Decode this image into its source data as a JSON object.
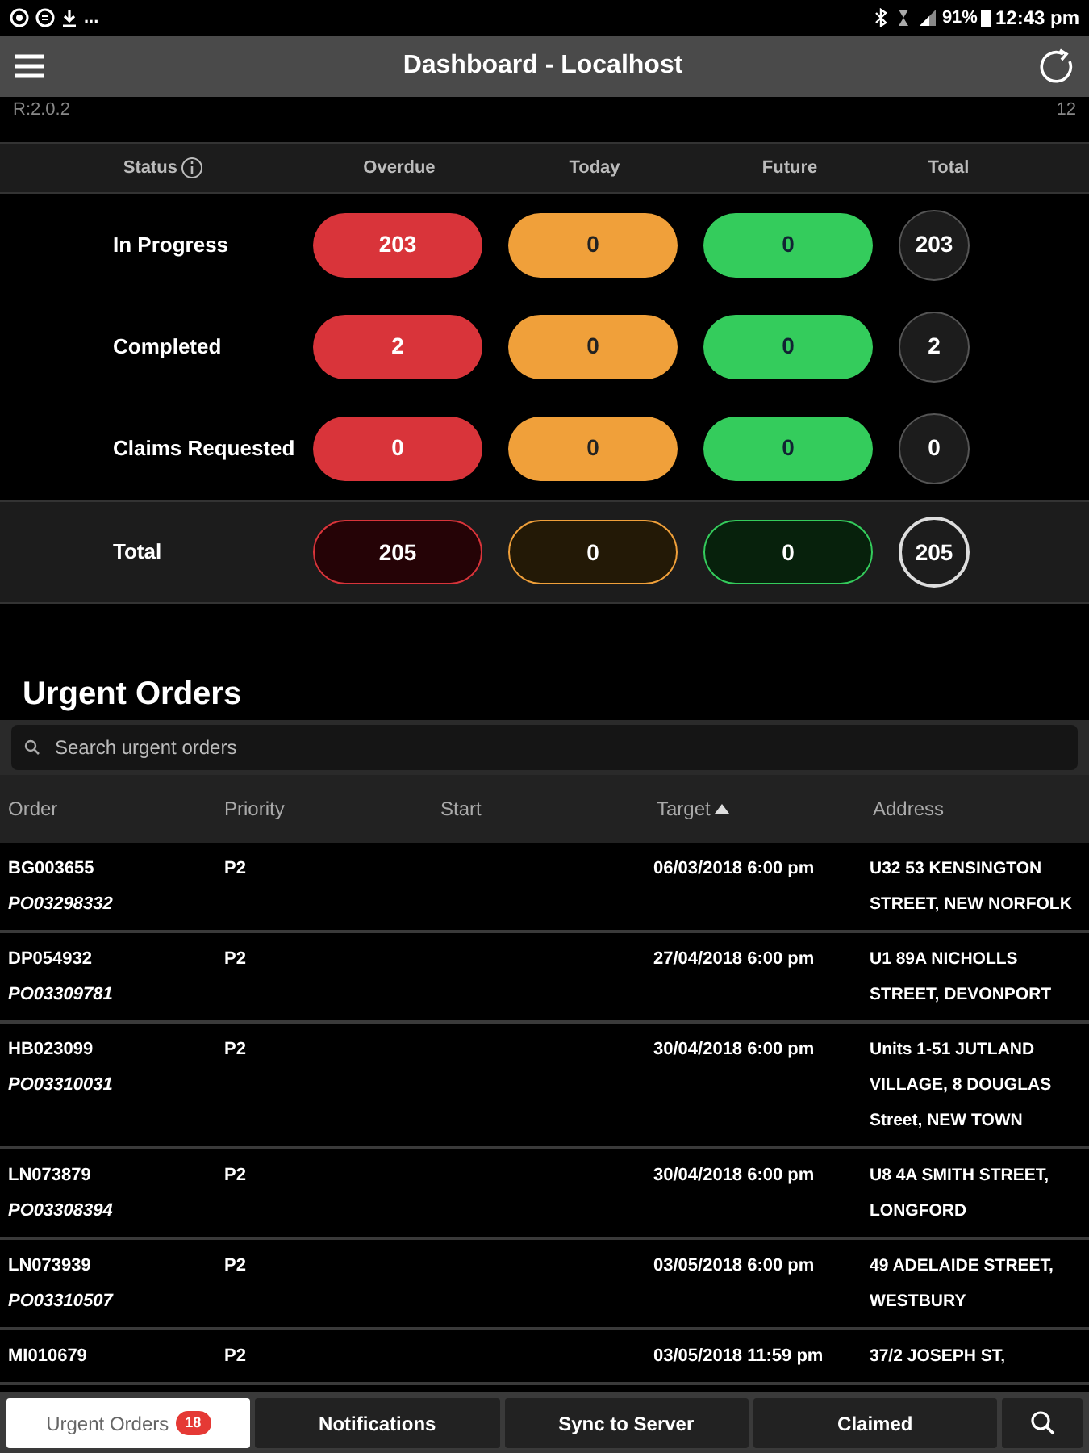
{
  "status_bar": {
    "overflow": "...",
    "battery": "91%",
    "time": "12:43 pm"
  },
  "header": {
    "title": "Dashboard - Localhost",
    "version": "R:2.0.2",
    "count": "12"
  },
  "summary": {
    "columns": [
      "Status",
      "Overdue",
      "Today",
      "Future",
      "Total"
    ],
    "rows": [
      {
        "kind": "status",
        "label": "In Progress",
        "overdue": "203",
        "today": "0",
        "future": "0",
        "total": "203"
      },
      {
        "kind": "status",
        "label": "Completed",
        "overdue": "2",
        "today": "0",
        "future": "0",
        "total": "2"
      },
      {
        "kind": "status",
        "label": "Claims Requested",
        "overdue": "0",
        "today": "0",
        "future": "0",
        "total": "0"
      },
      {
        "kind": "total",
        "label": "Total",
        "overdue": "205",
        "today": "0",
        "future": "0",
        "total": "205"
      }
    ]
  },
  "urgent_orders": {
    "title": "Urgent Orders",
    "search": {
      "placeholder": "Search urgent orders"
    },
    "columns": [
      {
        "label": "Order",
        "sorted": false
      },
      {
        "label": "Priority",
        "sorted": false
      },
      {
        "label": "Start",
        "sorted": false
      },
      {
        "label": "Target",
        "sorted": true
      },
      {
        "label": "Address",
        "sorted": false
      }
    ],
    "rows": [
      {
        "order": "BG003655",
        "po": "PO03298332",
        "priority": "P2",
        "target": "06/03/2018 6:00 pm",
        "address": [
          "U32 53 KENSINGTON",
          "STREET, NEW NORFOLK"
        ]
      },
      {
        "order": "DP054932",
        "po": "PO03309781",
        "priority": "P2",
        "target": "27/04/2018 6:00 pm",
        "address": [
          "U1 89A NICHOLLS",
          "STREET, DEVONPORT"
        ]
      },
      {
        "order": "HB023099",
        "po": "PO03310031",
        "priority": "P2",
        "target": "30/04/2018 6:00 pm",
        "address": [
          "Units 1-51 JUTLAND",
          "VILLAGE, 8 DOUGLAS",
          "Street, NEW TOWN"
        ]
      },
      {
        "order": "LN073879",
        "po": "PO03308394",
        "priority": "P2",
        "target": "30/04/2018 6:00 pm",
        "address": [
          "U8 4A SMITH STREET,",
          "LONGFORD"
        ]
      },
      {
        "order": "LN073939",
        "po": "PO03310507",
        "priority": "P2",
        "target": "03/05/2018 6:00 pm",
        "address": [
          "49 ADELAIDE STREET,",
          "WESTBURY"
        ]
      },
      {
        "order": "MI010679",
        "priority": "P2",
        "target": "03/05/2018 11:59 pm",
        "address": [
          "37/2 JOSEPH ST,"
        ]
      }
    ]
  },
  "bottom_tabs": [
    {
      "label": "Urgent Orders",
      "selected": true,
      "badge": "18"
    },
    {
      "label": "Notifications",
      "selected": false
    },
    {
      "label": "Sync to Server",
      "selected": false
    },
    {
      "label": "Claimed",
      "selected": false
    }
  ]
}
